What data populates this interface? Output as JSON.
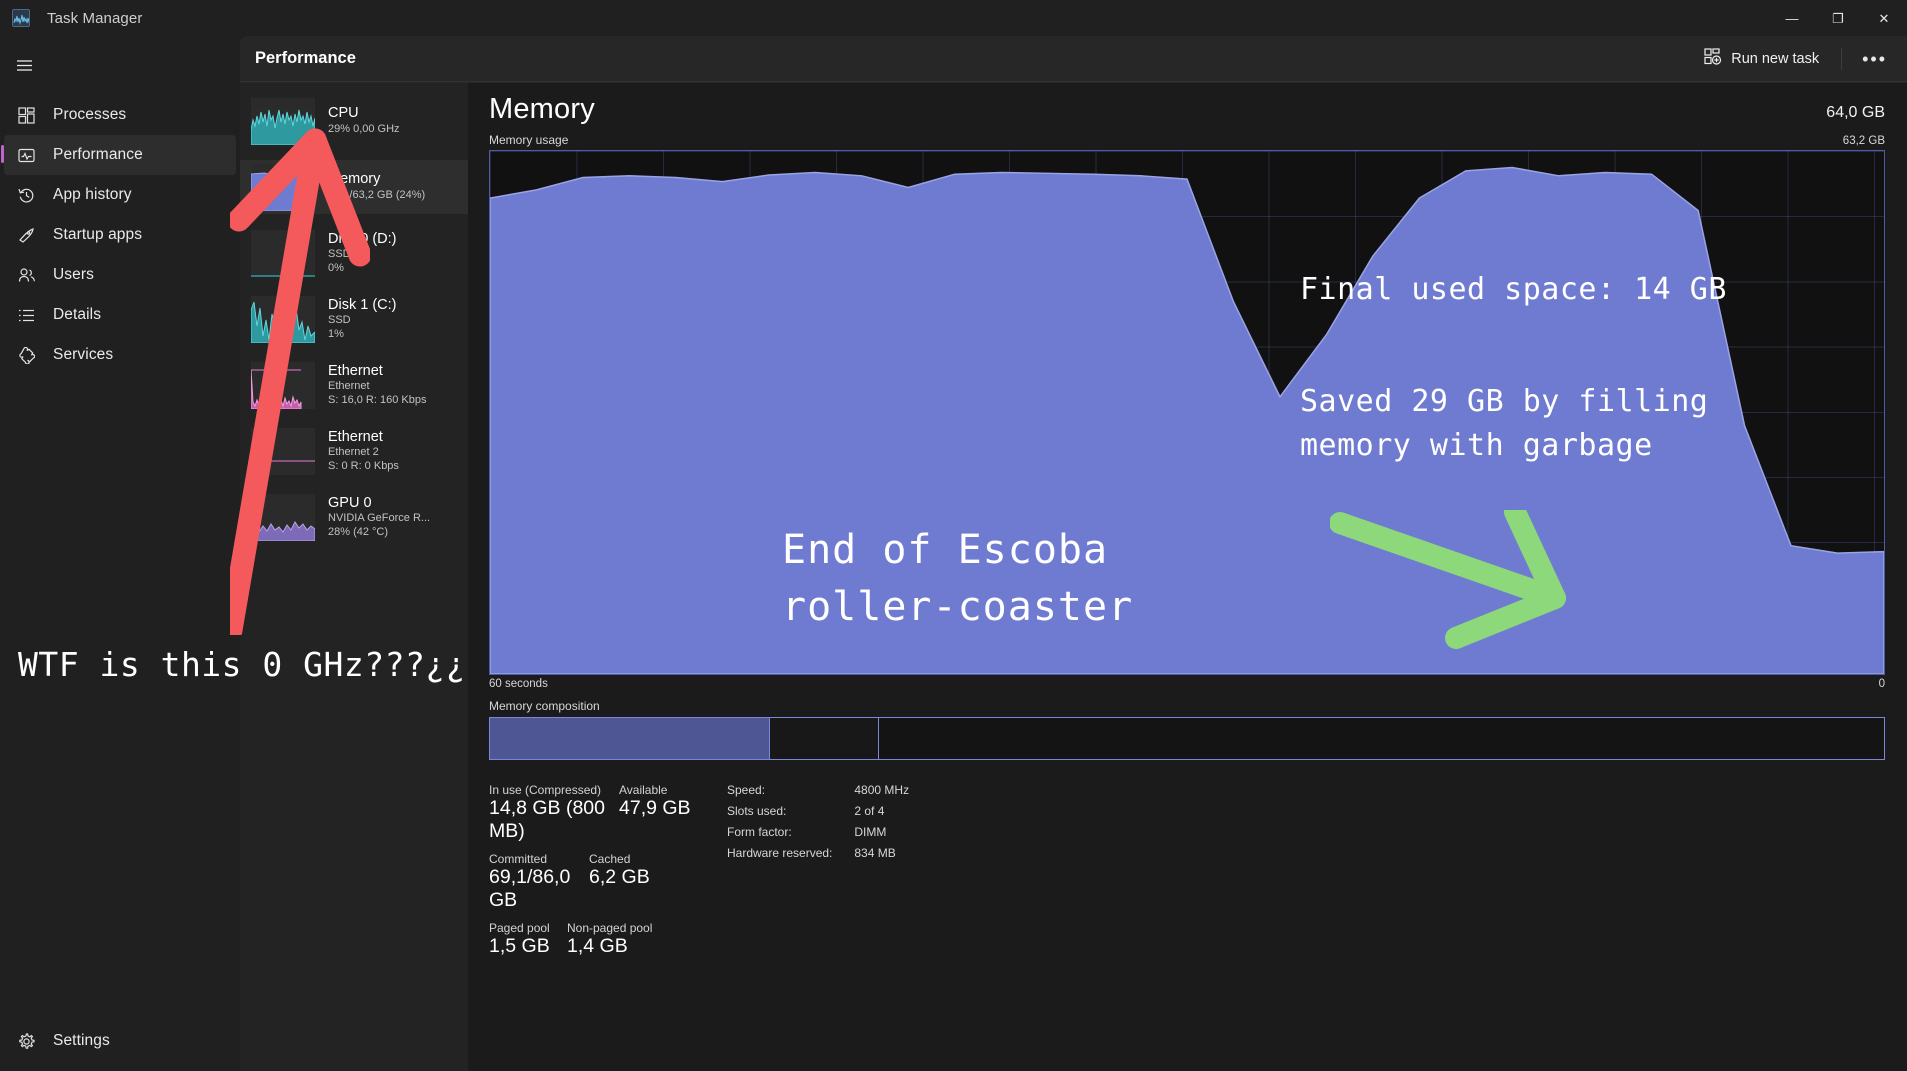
{
  "window": {
    "title": "Task Manager",
    "app_icon": "task-manager-icon",
    "minimize": "—",
    "maximize": "❐",
    "close": "✕"
  },
  "sidebar": {
    "hamburger_icon": "hamburger-menu-icon",
    "items": [
      {
        "label": "Processes",
        "icon": "processes-icon",
        "selected": false
      },
      {
        "label": "Performance",
        "icon": "performance-icon",
        "selected": true
      },
      {
        "label": "App history",
        "icon": "history-icon",
        "selected": false
      },
      {
        "label": "Startup apps",
        "icon": "rocket-icon",
        "selected": false
      },
      {
        "label": "Users",
        "icon": "users-icon",
        "selected": false
      },
      {
        "label": "Details",
        "icon": "list-icon",
        "selected": false
      },
      {
        "label": "Services",
        "icon": "services-icon",
        "selected": false
      }
    ],
    "settings": {
      "label": "Settings",
      "icon": "gear-icon"
    },
    "accent": "#bf64c8"
  },
  "header": {
    "page_title": "Performance",
    "run_new_task": "Run new task",
    "run_new_task_icon": "new-task-icon",
    "more_options": "•••"
  },
  "resources": [
    {
      "name": "CPU",
      "line2": "29%  0,00 GHz",
      "line3": "",
      "color": "#3fbfc8",
      "selected": false
    },
    {
      "name": "Memory",
      "line2": "15,1/63,2 GB (24%)",
      "line3": "",
      "color": "#6f7bd0",
      "selected": true
    },
    {
      "name": "Disk 0 (D:)",
      "line2": "SSD",
      "line3": "0%",
      "color": "#2e9aa0",
      "selected": false
    },
    {
      "name": "Disk 1 (C:)",
      "line2": "SSD",
      "line3": "1%",
      "color": "#2e9aa0",
      "selected": false
    },
    {
      "name": "Ethernet",
      "line2": "Ethernet",
      "line3": "S: 16,0 R: 160 Kbps",
      "color": "#e87ad0",
      "selected": false
    },
    {
      "name": "Ethernet",
      "line2": "Ethernet 2",
      "line3": "S: 0 R: 0 Kbps",
      "color": "#e87ad0",
      "selected": false
    },
    {
      "name": "GPU 0",
      "line2": "NVIDIA GeForce R...",
      "line3": "28%  (42 °C)",
      "color": "#9d86d6",
      "selected": false
    }
  ],
  "memory_panel": {
    "title": "Memory",
    "total": "64,0 GB",
    "graph_label": "Memory usage",
    "graph_max": "63,2 GB",
    "time_left": "60 seconds",
    "time_right": "0",
    "composition_label": "Memory composition",
    "graph_color": "#6f7bd0",
    "grid_color": "#4d5aa8",
    "stats": {
      "in_use_label": "In use (Compressed)",
      "in_use_value": "14,8 GB (800 MB)",
      "available_label": "Available",
      "available_value": "47,9 GB",
      "committed_label": "Committed",
      "committed_value": "69,1/86,0 GB",
      "cached_label": "Cached",
      "cached_value": "6,2 GB",
      "paged_label": "Paged pool",
      "paged_value": "1,5 GB",
      "nonpaged_label": "Non-paged pool",
      "nonpaged_value": "1,4 GB"
    },
    "hardware": [
      {
        "key": "Speed:",
        "value": "4800 MHz"
      },
      {
        "key": "Slots used:",
        "value": "2 of 4"
      },
      {
        "key": "Form factor:",
        "value": "DIMM"
      },
      {
        "key": "Hardware reserved:",
        "value": "834 MB"
      }
    ]
  },
  "annotations": {
    "final_used": "Final used space: 14 GB",
    "saved_line1": "Saved 29 GB by filling",
    "saved_line2": "memory with garbage",
    "end_line1": "End of Escoba",
    "end_line2": "roller-coaster",
    "wtf": "WTF is this 0 GHz???¿¿",
    "red_arrow_color": "#f4595c",
    "green_arrow_color": "#8cd87a"
  },
  "chart_data": {
    "type": "area",
    "title": "Memory usage",
    "xlabel": "60 seconds",
    "ylabel": "Memory",
    "ylim": [
      0,
      63.2
    ],
    "xlim": [
      60,
      0
    ],
    "grid": true,
    "legend": "none",
    "unit": "GB",
    "x": [
      0,
      2,
      4,
      6,
      8,
      10,
      12,
      14,
      16,
      18,
      20,
      22,
      24,
      26,
      28,
      30,
      32,
      34,
      36,
      38,
      40,
      42,
      44,
      46,
      48,
      50,
      52,
      54,
      56,
      58,
      60
    ],
    "values": [
      57.5,
      58.5,
      60.0,
      60.2,
      60.0,
      59.5,
      60.3,
      60.6,
      60.2,
      58.8,
      60.4,
      60.6,
      60.5,
      60.4,
      60.2,
      59.8,
      45.0,
      33.5,
      41.0,
      50.5,
      57.5,
      60.8,
      61.2,
      60.2,
      60.6,
      60.4,
      56.0,
      30.0,
      15.5,
      14.6,
      14.8
    ],
    "annotations": [
      {
        "text": "Final used space: 14 GB",
        "x": 24,
        "y": 52
      },
      {
        "text": "Saved 29 GB by filling memory with garbage",
        "x": 24,
        "y": 40
      },
      {
        "text": "End of Escoba roller-coaster",
        "x": 38,
        "y": 26
      }
    ]
  },
  "composition": {
    "in_use_pct": 20,
    "modified_pct": 7.8,
    "free_pct": 72.2
  }
}
